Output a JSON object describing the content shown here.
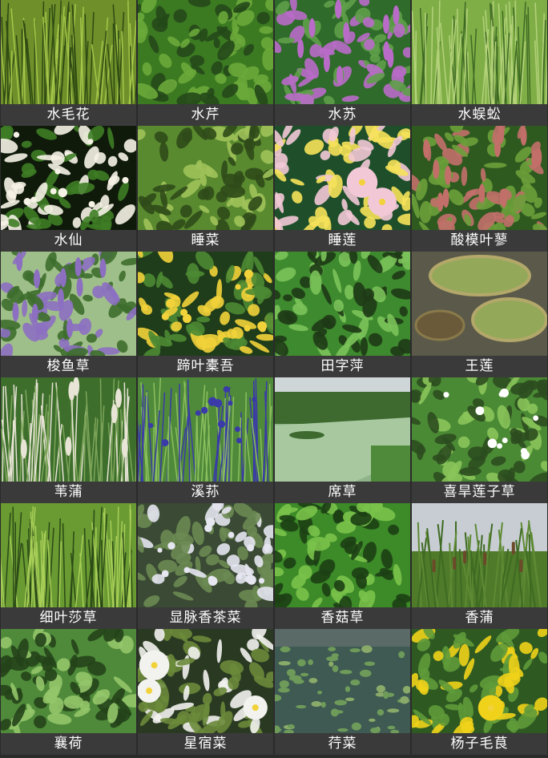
{
  "plants": [
    {
      "name": "水毛花",
      "photo": "reeds-green-stems",
      "colors": [
        "#6e8f2a",
        "#a6c84a",
        "#2f4a12"
      ]
    },
    {
      "name": "水芹",
      "photo": "leafy-groundcover",
      "colors": [
        "#3c7a22",
        "#6aa83a",
        "#25491a"
      ]
    },
    {
      "name": "水苏",
      "photo": "purple-flower-spikes",
      "colors": [
        "#2f6b2a",
        "#b96bc8",
        "#5fa04a"
      ]
    },
    {
      "name": "水蜈蚣",
      "photo": "grass-tuft",
      "colors": [
        "#7fae47",
        "#b4d27a",
        "#3f6a24"
      ]
    },
    {
      "name": "水仙",
      "photo": "white-daffodils-dark",
      "colors": [
        "#0f1a0b",
        "#f6f3e6",
        "#3e7d25"
      ]
    },
    {
      "name": "睡菜",
      "photo": "broad-leaf-clump",
      "colors": [
        "#5a8a2f",
        "#9ec25a",
        "#2f4a1a"
      ]
    },
    {
      "name": "睡莲",
      "photo": "pink-waterlily",
      "colors": [
        "#1e4f2a",
        "#f2c8d6",
        "#f6e25a"
      ]
    },
    {
      "name": "酸模叶蓼",
      "photo": "red-seed-spikes",
      "colors": [
        "#2e5a1f",
        "#c26f6a",
        "#6b9e3a"
      ]
    },
    {
      "name": "梭鱼草",
      "photo": "violet-spikes-leaves",
      "colors": [
        "#9fbf8a",
        "#8c6fc1",
        "#3d6e2c"
      ]
    },
    {
      "name": "蹄叶橐吾",
      "photo": "yellow-flowers-shade",
      "colors": [
        "#1f3d1a",
        "#f2d23a",
        "#4c8a34"
      ]
    },
    {
      "name": "田字萍",
      "photo": "clover-water-fern",
      "colors": [
        "#3e8a2e",
        "#7bc25a",
        "#1e3a16"
      ]
    },
    {
      "name": "王莲",
      "photo": "giant-lily-pads",
      "colors": [
        "#5b5a4a",
        "#94a85a",
        "#3b3a2f"
      ]
    },
    {
      "name": "苇蒲",
      "photo": "pampas-plumes",
      "colors": [
        "#3d6e2c",
        "#e8e4d6",
        "#7da55a"
      ]
    },
    {
      "name": "溪荪",
      "photo": "blue-iris",
      "colors": [
        "#4f8a3a",
        "#3a3aa8",
        "#8bbf5e"
      ]
    },
    {
      "name": "席草",
      "photo": "field-water",
      "colors": [
        "#8fb48a",
        "#a8c9a0",
        "#3e6a30"
      ]
    },
    {
      "name": "喜旱莲子草",
      "photo": "dense-weed",
      "colors": [
        "#4b8a35",
        "#8ac45a",
        "#2c4d1f"
      ]
    },
    {
      "name": "细叶莎草",
      "photo": "umbrella-sedge",
      "colors": [
        "#6a9a32",
        "#a8cf58",
        "#2a4a16"
      ]
    },
    {
      "name": "显脉香茶菜",
      "photo": "small-white-flowers-shade",
      "colors": [
        "#3a4a34",
        "#e6e6f0",
        "#6b8a52"
      ]
    },
    {
      "name": "香菇草",
      "photo": "pennywort-round-leaves",
      "colors": [
        "#3c8a28",
        "#7ac24a",
        "#1c3f14"
      ]
    },
    {
      "name": "香蒲",
      "photo": "cattails-sky",
      "colors": [
        "#c8cdd4",
        "#4e7a2a",
        "#6b4a2a"
      ]
    },
    {
      "name": "襄荷",
      "photo": "ginger-leaves",
      "colors": [
        "#4f8a3a",
        "#93c56a",
        "#24421a"
      ]
    },
    {
      "name": "星宿菜",
      "photo": "white-flower-clusters",
      "colors": [
        "#2a3a22",
        "#f2f2ee",
        "#6a8a3a"
      ]
    },
    {
      "name": "荇菜",
      "photo": "pond-floating-leaves",
      "colors": [
        "#3e5a52",
        "#6e9a5a",
        "#2a3a44"
      ]
    },
    {
      "name": "杨子毛茛",
      "photo": "yellow-buttercup",
      "colors": [
        "#2e5a22",
        "#f0d21a",
        "#5f9a3a"
      ]
    }
  ]
}
